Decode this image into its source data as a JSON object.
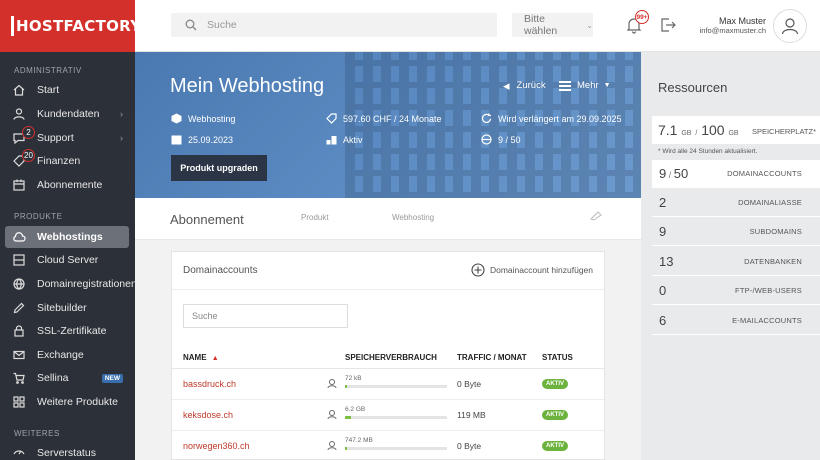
{
  "brand": {
    "name": "HOSTFACTORY",
    "color": "#d4302b"
  },
  "sidebar": {
    "sections": [
      {
        "title": "ADMINISTRATIV"
      },
      {
        "title": "PRODUKTE"
      },
      {
        "title": "WEITERES"
      }
    ],
    "items": [
      {
        "label": "Start",
        "icon": "house-icon"
      },
      {
        "label": "Kundendaten",
        "icon": "user-icon",
        "has_children": true
      },
      {
        "label": "Support",
        "icon": "chat-icon",
        "badge": "2",
        "has_children": true
      },
      {
        "label": "Finanzen",
        "icon": "tag-icon",
        "badge": "20"
      },
      {
        "label": "Abonnemente",
        "icon": "calendar-icon"
      },
      {
        "label": "Webhostings",
        "icon": "cloud-icon",
        "active": true
      },
      {
        "label": "Cloud Server",
        "icon": "server-icon"
      },
      {
        "label": "Domainregistrationen",
        "icon": "globe-icon"
      },
      {
        "label": "Sitebuilder",
        "icon": "pen-icon"
      },
      {
        "label": "SSL-Zertifikate",
        "icon": "lock-icon"
      },
      {
        "label": "Exchange",
        "icon": "mail-icon"
      },
      {
        "label": "Sellina",
        "icon": "cart-icon",
        "tag": "NEW"
      },
      {
        "label": "Weitere Produkte",
        "icon": "grid-icon"
      },
      {
        "label": "Serverstatus",
        "icon": "status-icon"
      }
    ]
  },
  "topbar": {
    "search_placeholder": "Suche",
    "select_value": "Bitte wählen",
    "notifications_badge": "99+",
    "user_name": "Max Muster",
    "user_email": "info@maxmuster.ch"
  },
  "hero": {
    "title": "Mein Webhosting",
    "back_label": "Zurück",
    "more_label": "Mehr",
    "facts": {
      "package": "Webhosting",
      "price": "597.60 CHF / 24 Monate",
      "renewal": "Wird verlängert am 29.09.2025",
      "date": "25.09.2023",
      "status": "Aktiv",
      "count": "9 / 50"
    },
    "upgrade_label": "Produkt upgraden"
  },
  "subnav": {
    "title": "Abonnement",
    "tabs": [
      "Produkt",
      "Webhosting"
    ]
  },
  "domains_card": {
    "title": "Domainaccounts",
    "add_label": "Domainaccount hinzufügen",
    "search_placeholder": "Suche",
    "columns": [
      "NAME",
      "SPEICHERVERBRAUCH",
      "TRAFFIC / MONAT",
      "STATUS"
    ],
    "rows": [
      {
        "name": "bassdruck.ch",
        "storage": "72 kB",
        "storage_fraction": 0.01,
        "traffic": "0 Byte",
        "status": "AKTIV"
      },
      {
        "name": "keksdose.ch",
        "storage": "6.2 GB",
        "storage_fraction": 0.06,
        "traffic": "119 MB",
        "status": "AKTIV"
      },
      {
        "name": "norwegen360.ch",
        "storage": "747.2 MB",
        "storage_fraction": 0.01,
        "traffic": "0 Byte",
        "status": "AKTIV"
      }
    ]
  },
  "resources": {
    "title": "Ressourcen",
    "storage": {
      "used": "7.1",
      "used_unit": "GB",
      "separator": "/",
      "total": "100",
      "total_unit": "GB",
      "label": "SPEICHERPLATZ*"
    },
    "note": "* Wird alle 24 Stunden aktualisiert.",
    "rows": [
      {
        "value": "9",
        "max": "50",
        "label": "DOMAINACCOUNTS"
      },
      {
        "value": "2",
        "label": "DOMAINALIASSE"
      },
      {
        "value": "9",
        "label": "SUBDOMAINS"
      },
      {
        "value": "13",
        "label": "DATENBANKEN"
      },
      {
        "value": "0",
        "label": "FTP-/WEB-USERS"
      },
      {
        "value": "6",
        "label": "E-MAILACCOUNTS"
      }
    ]
  }
}
